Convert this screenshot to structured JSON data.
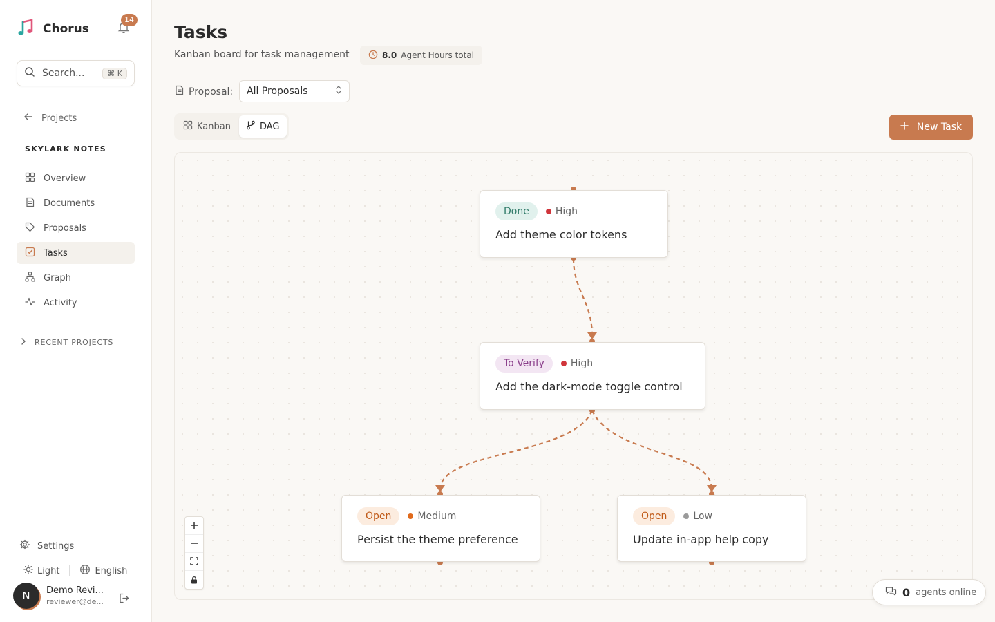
{
  "app": {
    "name": "Chorus",
    "notification_count": "14"
  },
  "search": {
    "label": "Search...",
    "shortcut": "⌘ K"
  },
  "nav": {
    "back_label": "Projects",
    "project_name": "SKYLARK NOTES",
    "items": [
      {
        "label": "Overview",
        "icon": "grid-icon"
      },
      {
        "label": "Documents",
        "icon": "document-icon"
      },
      {
        "label": "Proposals",
        "icon": "tag-icon"
      },
      {
        "label": "Tasks",
        "icon": "checkbox-icon",
        "active": true
      },
      {
        "label": "Graph",
        "icon": "graph-icon"
      },
      {
        "label": "Activity",
        "icon": "activity-icon"
      }
    ],
    "recent_label": "RECENT PROJECTS"
  },
  "footer": {
    "settings_label": "Settings",
    "theme_label": "Light",
    "language_label": "English",
    "user": {
      "initial": "N",
      "name": "Demo Revi...",
      "email": "reviewer@de..."
    }
  },
  "header": {
    "title": "Tasks",
    "subtitle": "Kanban board for task management",
    "hours_value": "8.0",
    "hours_label": "Agent Hours total"
  },
  "filter": {
    "label": "Proposal:",
    "value": "All Proposals"
  },
  "view": {
    "kanban_label": "Kanban",
    "dag_label": "DAG",
    "active": "DAG"
  },
  "new_task_label": "New Task",
  "dag": {
    "nodes": [
      {
        "status": "Done",
        "priority": "High",
        "title": "Add theme color tokens"
      },
      {
        "status": "To Verify",
        "priority": "High",
        "title": "Add the dark-mode toggle control"
      },
      {
        "status": "Open",
        "priority": "Medium",
        "title": "Persist the theme preference"
      },
      {
        "status": "Open",
        "priority": "Low",
        "title": "Update in-app help copy"
      }
    ],
    "edges": [
      {
        "from": "Add theme color tokens",
        "to": "Add the dark-mode toggle control"
      },
      {
        "from": "Add the dark-mode toggle control",
        "to": "Persist the theme preference"
      },
      {
        "from": "Add the dark-mode toggle control",
        "to": "Update in-app help copy"
      }
    ]
  },
  "colors": {
    "accent": "#c87a4f",
    "status_done_bg": "#e1f1ed",
    "status_done_fg": "#2f7a68",
    "status_verify_bg": "#f3e6f3",
    "status_verify_fg": "#8a3d8a",
    "status_open_bg": "#fcecdf",
    "status_open_fg": "#c05a18",
    "priority_high": "#d0353b",
    "priority_medium": "#e06a1c",
    "priority_low": "#9a9a9a"
  },
  "agents": {
    "count": "0",
    "label": "agents online"
  }
}
